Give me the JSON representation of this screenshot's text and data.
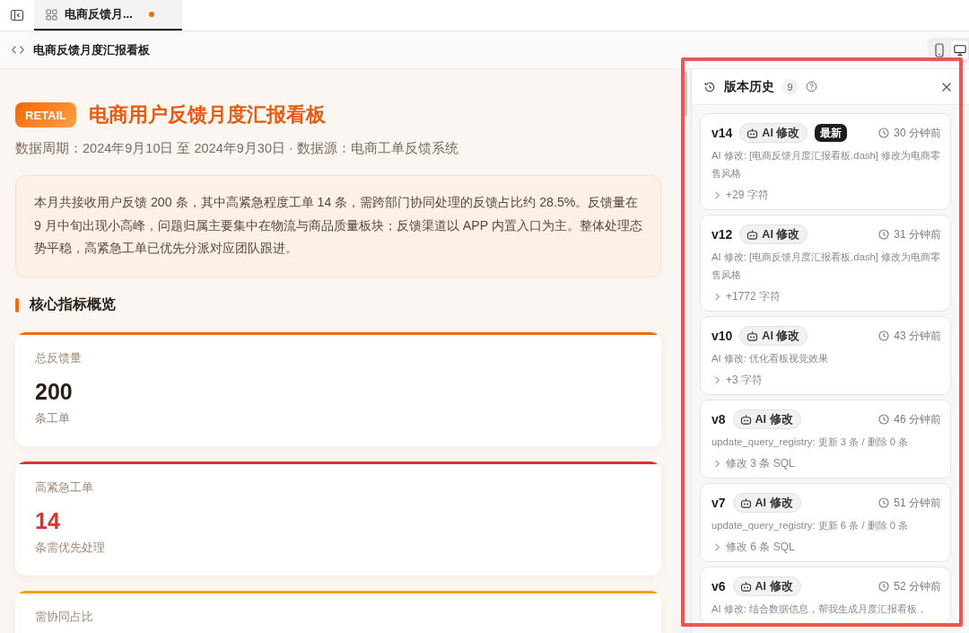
{
  "tabs": [
    {
      "label": "电商反馈月...",
      "selected": true,
      "modified": true
    }
  ],
  "toolbar": {
    "title": "电商反馈月度汇报看板",
    "view_modes": [
      {
        "kind": "mobile",
        "selected": false
      },
      {
        "kind": "desktop",
        "selected": true
      }
    ]
  },
  "dashboard": {
    "badge": "RETAIL",
    "title": "电商用户反馈月度汇报看板",
    "subtitle": "数据周期：2024年9月10日 至 2024年9月30日 · 数据源：电商工单反馈系统",
    "summary": "本月共接收用户反馈 200 条，其中高紧急程度工单 14 条，需跨部门协同处理的反馈占比约 28.5%。反馈量在 9 月中旬出现小高峰，问题归属主要集中在物流与商品质量板块；反馈渠道以 APP 内置入口为主。整体处理态势平稳，高紧急工单已优先分派对应团队跟进。",
    "section_title": "核心指标概览",
    "metrics": [
      {
        "label": "总反馈量",
        "value": "200",
        "unit": "条工单",
        "color": "#f76707",
        "emphasis": false
      },
      {
        "label": "高紧急工单",
        "value": "14",
        "unit": "条需优先处理",
        "color": "#e03131",
        "emphasis": true
      },
      {
        "label": "需协同占比",
        "color": "#f59f00"
      }
    ]
  },
  "version_history": {
    "title": "版本历史",
    "count": "9",
    "versions": [
      {
        "version": "v14",
        "source": "AI 修改",
        "badge": "最新",
        "time": "30 分钟前",
        "description": "AI 修改: [电商反馈月度汇报看板.dash] 修改为电商零售风格",
        "change": "+29 字符",
        "expanded": false
      },
      {
        "version": "v12",
        "source": "AI 修改",
        "time": "31 分钟前",
        "description": "AI 修改: [电商反馈月度汇报看板.dash] 修改为电商零售风格",
        "change": "+1772 字符",
        "expanded": false
      },
      {
        "version": "v10",
        "source": "AI 修改",
        "time": "43 分钟前",
        "description": "AI 修改: 优化看板视觉效果",
        "change": "+3 字符",
        "expanded": false
      },
      {
        "version": "v8",
        "source": "AI 修改",
        "time": "46 分钟前",
        "description": "update_query_registry: 更新 3 条 / 删除 0 条",
        "change": "修改 3 条 SQL",
        "expanded": false
      },
      {
        "version": "v7",
        "source": "AI 修改",
        "time": "51 分钟前",
        "description": "update_query_registry: 更新 6 条 / 删除 0 条",
        "change": "修改 6 条 SQL",
        "expanded": false
      },
      {
        "version": "v6",
        "source": "AI 修改",
        "time": "52 分钟前",
        "description": "AI 修改: 结合数据信息，帮我生成月度汇报看板，"
      }
    ]
  }
}
